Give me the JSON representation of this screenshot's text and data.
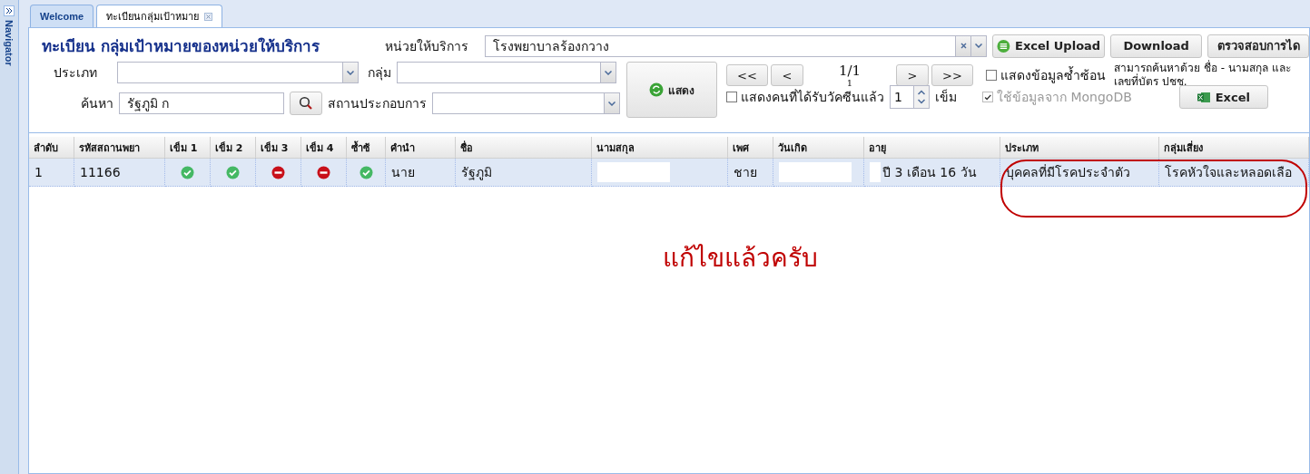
{
  "navigator": {
    "label": "Navigator"
  },
  "tabs": [
    {
      "label": "Welcome",
      "selected": false,
      "closable": false
    },
    {
      "label": "ทะเบียนกลุ่มเป้าหมาย",
      "selected": true,
      "closable": true
    }
  ],
  "title": "ทะเบียน กลุ่มเป้าหมายของหน่วยให้บริการ",
  "unit": {
    "label": "หน่วยให้บริการ",
    "value": "โรงพยาบาลร้องกวาง"
  },
  "top_buttons": [
    {
      "label": "Excel Upload"
    },
    {
      "label": "Download"
    },
    {
      "label": "ตรวจสอบการได"
    }
  ],
  "type_filter": {
    "label": "ประเภท"
  },
  "group_filter": {
    "label": "กลุ่ม"
  },
  "search": {
    "label": "ค้นหา",
    "value": "รัฐภูมิ ก"
  },
  "workplace": {
    "label": "สถานประกอบการ"
  },
  "show_button": "แสดง",
  "pager": {
    "first": "<<",
    "prev": "<",
    "page": "1/1",
    "total": "1",
    "next": ">",
    "last": ">>"
  },
  "duplicate_option": {
    "label": "แสดงข้อมูลซ้ำซ้อน",
    "checked": false
  },
  "hint": "สามารถค้นหาด้วย ชื่อ - นามสกุล และ เลขที่บัตร ปชช.",
  "vaccinated_option": {
    "label": "แสดงคนที่ได้รับวัคซีนแล้ว",
    "checked": false,
    "dose": "1",
    "unit": "เข็ม"
  },
  "mongo_option": {
    "label": "ใช้ข้อมูลจาก MongoDB",
    "checked": true,
    "disabled": true
  },
  "excel_button": "Excel",
  "table": {
    "columns": [
      "ลำดับ",
      "รหัสสถานพยา",
      "เข็ม 1",
      "เข็ม 2",
      "เข็ม 3",
      "เข็ม 4",
      "ซ้ำซ้",
      "คำนำ",
      "ชื่อ",
      "นามสกุล",
      "เพศ",
      "วันเกิด",
      "อายุ",
      "ประเภท",
      "กลุ่มเสี่ยง"
    ],
    "rows": [
      {
        "selected": true,
        "cells": [
          {
            "kind": "text",
            "text": "1"
          },
          {
            "kind": "text",
            "text": "11166"
          },
          {
            "kind": "status",
            "done": true
          },
          {
            "kind": "status",
            "done": true
          },
          {
            "kind": "status",
            "done": false
          },
          {
            "kind": "status",
            "done": false
          },
          {
            "kind": "status",
            "done": true
          },
          {
            "kind": "text",
            "text": "นาย"
          },
          {
            "kind": "text",
            "text": "รัฐภูมิ"
          },
          {
            "kind": "redacted"
          },
          {
            "kind": "text",
            "text": "ชาย"
          },
          {
            "kind": "redacted"
          },
          {
            "kind": "partly_redacted",
            "text": "ปี 3 เดือน 16 วัน"
          },
          {
            "kind": "text",
            "text": "บุคคลที่มีโรคประจำตัว"
          },
          {
            "kind": "text",
            "text": "โรคหัวใจและหลอดเลือ"
          }
        ]
      }
    ]
  },
  "annotation": {
    "text": "แก้ไขแล้วครับ"
  }
}
